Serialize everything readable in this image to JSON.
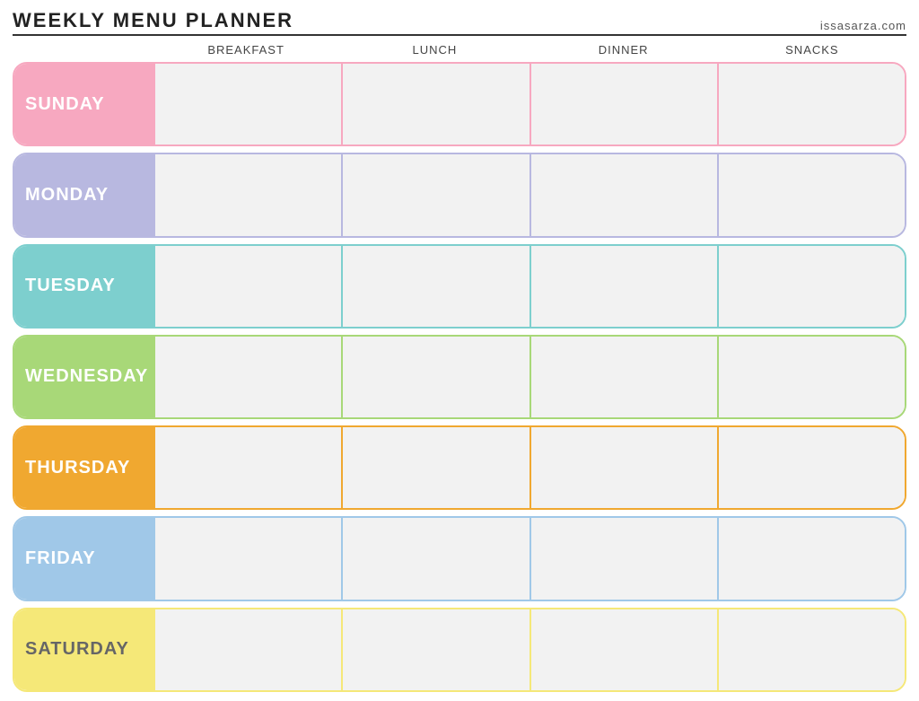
{
  "header": {
    "title": "Weekly Menu Planner",
    "website": "issasarza.com"
  },
  "columns": {
    "empty": "",
    "breakfast": "Breakfast",
    "lunch": "Lunch",
    "dinner": "Dinner",
    "snacks": "Snacks"
  },
  "days": [
    {
      "id": "sunday",
      "label": "Sunday",
      "rowClass": "row-sunday"
    },
    {
      "id": "monday",
      "label": "Monday",
      "rowClass": "row-monday"
    },
    {
      "id": "tuesday",
      "label": "Tuesday",
      "rowClass": "row-tuesday"
    },
    {
      "id": "wednesday",
      "label": "Wednesday",
      "rowClass": "row-wednesday"
    },
    {
      "id": "thursday",
      "label": "Thursday",
      "rowClass": "row-thursday"
    },
    {
      "id": "friday",
      "label": "Friday",
      "rowClass": "row-friday"
    },
    {
      "id": "saturday",
      "label": "Saturday",
      "rowClass": "row-saturday"
    }
  ]
}
